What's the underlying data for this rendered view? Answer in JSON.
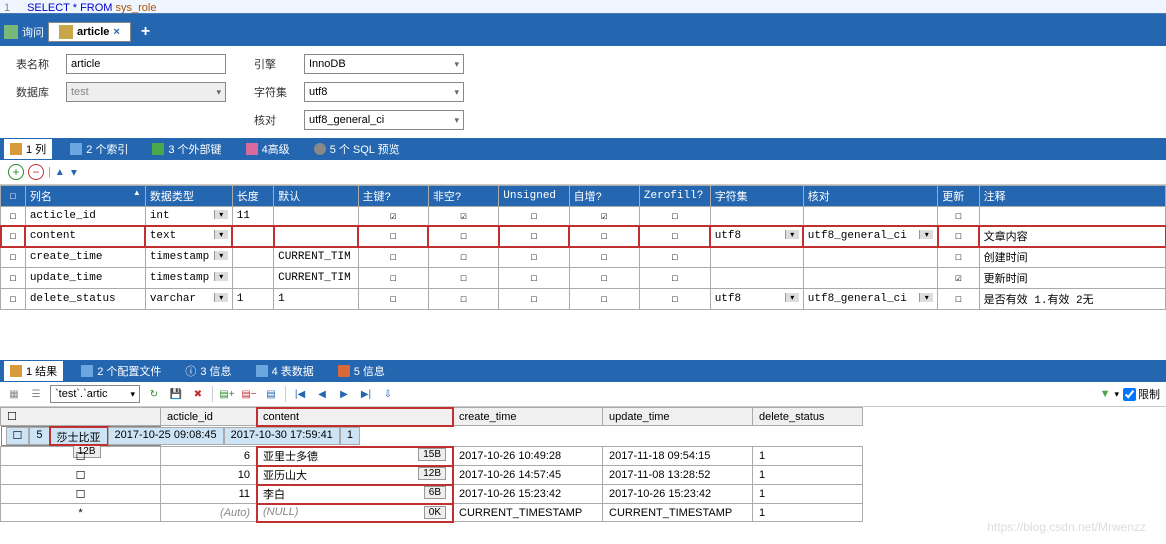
{
  "sql": {
    "line_no": "1",
    "select": "SELECT",
    "star": "*",
    "from": "FROM",
    "table": "sys_role"
  },
  "tabs": {
    "query": "询问",
    "article": "article",
    "close": "×",
    "plus": "+"
  },
  "form": {
    "table_name_label": "表名称",
    "table_name_value": "article",
    "database_label": "数据库",
    "database_value": "test",
    "engine_label": "引擎",
    "engine_value": "InnoDB",
    "charset_label": "字符集",
    "charset_value": "utf8",
    "collation_label": "核对",
    "collation_value": "utf8_general_ci"
  },
  "sub_tabs": {
    "cols": "1 列",
    "idx": "2 个索引",
    "fk": "3 个外部键",
    "adv": "4高级",
    "sql": "5 个 SQL 预览"
  },
  "col_grid": {
    "headers": {
      "name": "列名",
      "type": "数据类型",
      "len": "长度",
      "def": "默认",
      "pk": "主键?",
      "nn": "非空?",
      "un": "Unsigned",
      "ai": "自增?",
      "zf": "Zerofill?",
      "cs": "字符集",
      "coll": "核对",
      "upd": "更新",
      "cmnt": "注释"
    },
    "rows": [
      {
        "name": "acticle_id",
        "type": "int",
        "len": "11",
        "def": "",
        "pk": true,
        "nn": true,
        "un": false,
        "ai": true,
        "zf": false,
        "cs": "",
        "coll": "",
        "upd": false,
        "cmnt": ""
      },
      {
        "name": "content",
        "type": "text",
        "len": "",
        "def": "",
        "pk": false,
        "nn": false,
        "un": false,
        "ai": false,
        "zf": false,
        "cs": "utf8",
        "coll": "utf8_general_ci",
        "upd": false,
        "cmnt": "文章内容",
        "selected": true
      },
      {
        "name": "create_time",
        "type": "timestamp",
        "len": "",
        "def": "CURRENT_TIM",
        "pk": false,
        "nn": false,
        "un": false,
        "ai": false,
        "zf": false,
        "cs": "",
        "coll": "",
        "upd": false,
        "cmnt": "创建时间"
      },
      {
        "name": "update_time",
        "type": "timestamp",
        "len": "",
        "def": "CURRENT_TIM",
        "pk": false,
        "nn": false,
        "un": false,
        "ai": false,
        "zf": false,
        "cs": "",
        "coll": "",
        "upd": true,
        "cmnt": "更新时间"
      },
      {
        "name": "delete_status",
        "type": "varchar",
        "len": "1",
        "def": "1",
        "pk": false,
        "nn": false,
        "un": false,
        "ai": false,
        "zf": false,
        "cs": "utf8",
        "coll": "utf8_general_ci",
        "upd": false,
        "cmnt": "是否有效  1.有效  2无"
      }
    ]
  },
  "result_tabs": {
    "r1": "1 结果",
    "r2": "2 个配置文件",
    "r3": "3 信息",
    "r4": "4 表数据",
    "r5": "5 信息"
  },
  "result_toolbar": {
    "db_combo": "`test`.`artic",
    "limit": "限制"
  },
  "results": {
    "headers": {
      "id": "acticle_id",
      "content": "content",
      "ct": "create_time",
      "ut": "update_time",
      "ds": "delete_status"
    },
    "rows": [
      {
        "id": "5",
        "content": "莎士比亚",
        "size": "12B",
        "ct": "2017-10-25 09:08:45",
        "ut": "2017-10-30 17:59:41",
        "ds": "1",
        "sel": true
      },
      {
        "id": "6",
        "content": "亚里士多德",
        "size": "15B",
        "ct": "2017-10-26 10:49:28",
        "ut": "2017-11-18 09:54:15",
        "ds": "1"
      },
      {
        "id": "10",
        "content": "亚历山大",
        "size": "12B",
        "ct": "2017-10-26 14:57:45",
        "ut": "2017-11-08 13:28:52",
        "ds": "1"
      },
      {
        "id": "11",
        "content": "李白",
        "size": "6B",
        "ct": "2017-10-26 15:23:42",
        "ut": "2017-10-26 15:23:42",
        "ds": "1"
      },
      {
        "id": "(Auto)",
        "content": "(NULL)",
        "size": "0K",
        "ct": "CURRENT_TIMESTAMP",
        "ut": "CURRENT_TIMESTAMP",
        "ds": "1",
        "new": true
      }
    ]
  },
  "watermark": "https://blog.csdn.net/Mrwenzz"
}
